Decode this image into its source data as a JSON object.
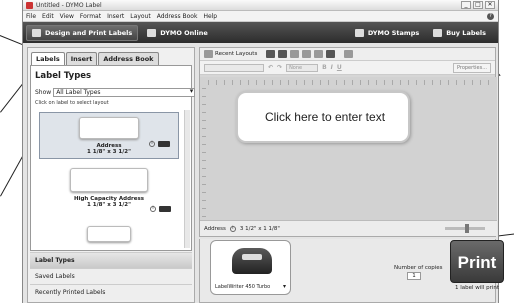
{
  "window": {
    "title": "Untitled - DYMO Label",
    "buttons": [
      "_",
      "□",
      "✕"
    ]
  },
  "menu": [
    "File",
    "Edit",
    "View",
    "Format",
    "Insert",
    "Layout",
    "Address Book",
    "Help"
  ],
  "help_icon": "?",
  "topbar": {
    "design_print": "Design and Print Labels",
    "dymo_online": "DYMO Online",
    "dymo_stamps": "DYMO Stamps",
    "buy_labels": "Buy Labels"
  },
  "left_panel": {
    "tabs": [
      "Labels",
      "Insert",
      "Address Book"
    ],
    "active_tab": "Labels",
    "title": "Label Types",
    "show_label": "Show",
    "show_value": "All Label Types",
    "hint": "Click on label to select layout",
    "labels": [
      {
        "name": "Address",
        "size": "1 1/8\" x 3 1/2\""
      },
      {
        "name": "High Capacity Address",
        "size": "1 1/8\" x 3 1/2\""
      }
    ],
    "sections": [
      "Label Types",
      "Saved Labels",
      "Recently Printed Labels"
    ]
  },
  "editor": {
    "recent_layouts": "Recent Layouts",
    "font_placeholder": "None",
    "properties": "Properties...",
    "text_prompt": "Click here to enter text",
    "status_label": "Address",
    "status_size": "3 1/2\" x 1 1/8\"",
    "zoom_fraction": 0.55
  },
  "printer": {
    "name": "LabelWriter 450 Turbo",
    "copies_label": "Number of copies",
    "copies_value": "1",
    "print_label": "Print",
    "will_print": "1 label will print"
  },
  "colors": {
    "topbar": "#2c2c2c",
    "print_button": "#4a4a4a"
  }
}
